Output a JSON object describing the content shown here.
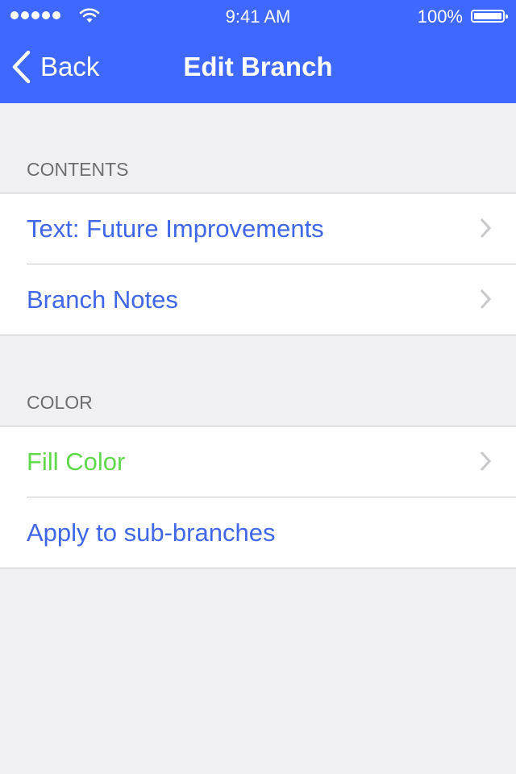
{
  "status_bar": {
    "signal_icon": "signal-dots-icon",
    "wifi_icon": "wifi-icon",
    "time": "9:41 AM",
    "battery_percent": "100%",
    "battery_icon": "battery-icon",
    "battery_level": 1.0
  },
  "nav": {
    "back_icon": "chevron-left-icon",
    "back_label": "Back",
    "title": "Edit Branch"
  },
  "sections": [
    {
      "header": "CONTENTS",
      "items": [
        {
          "label": "Text: Future Improvements",
          "has_chevron": true,
          "color": "#3f67e6"
        },
        {
          "label": "Branch Notes",
          "has_chevron": true,
          "color": "#3f67e6"
        }
      ]
    },
    {
      "header": "COLOR",
      "items": [
        {
          "label": "Fill Color",
          "has_chevron": true,
          "color": "#5fd94a"
        },
        {
          "label": "Apply to sub-branches",
          "has_chevron": false,
          "color": "#3f67e6"
        }
      ]
    }
  ],
  "colors": {
    "nav_background": "#3f69fe",
    "page_background": "#efeff4",
    "link_blue": "#3f67e6",
    "fill_color_green": "#5fd94a",
    "section_header_gray": "#6d6d72",
    "chevron_gray": "#c7c7cc"
  }
}
